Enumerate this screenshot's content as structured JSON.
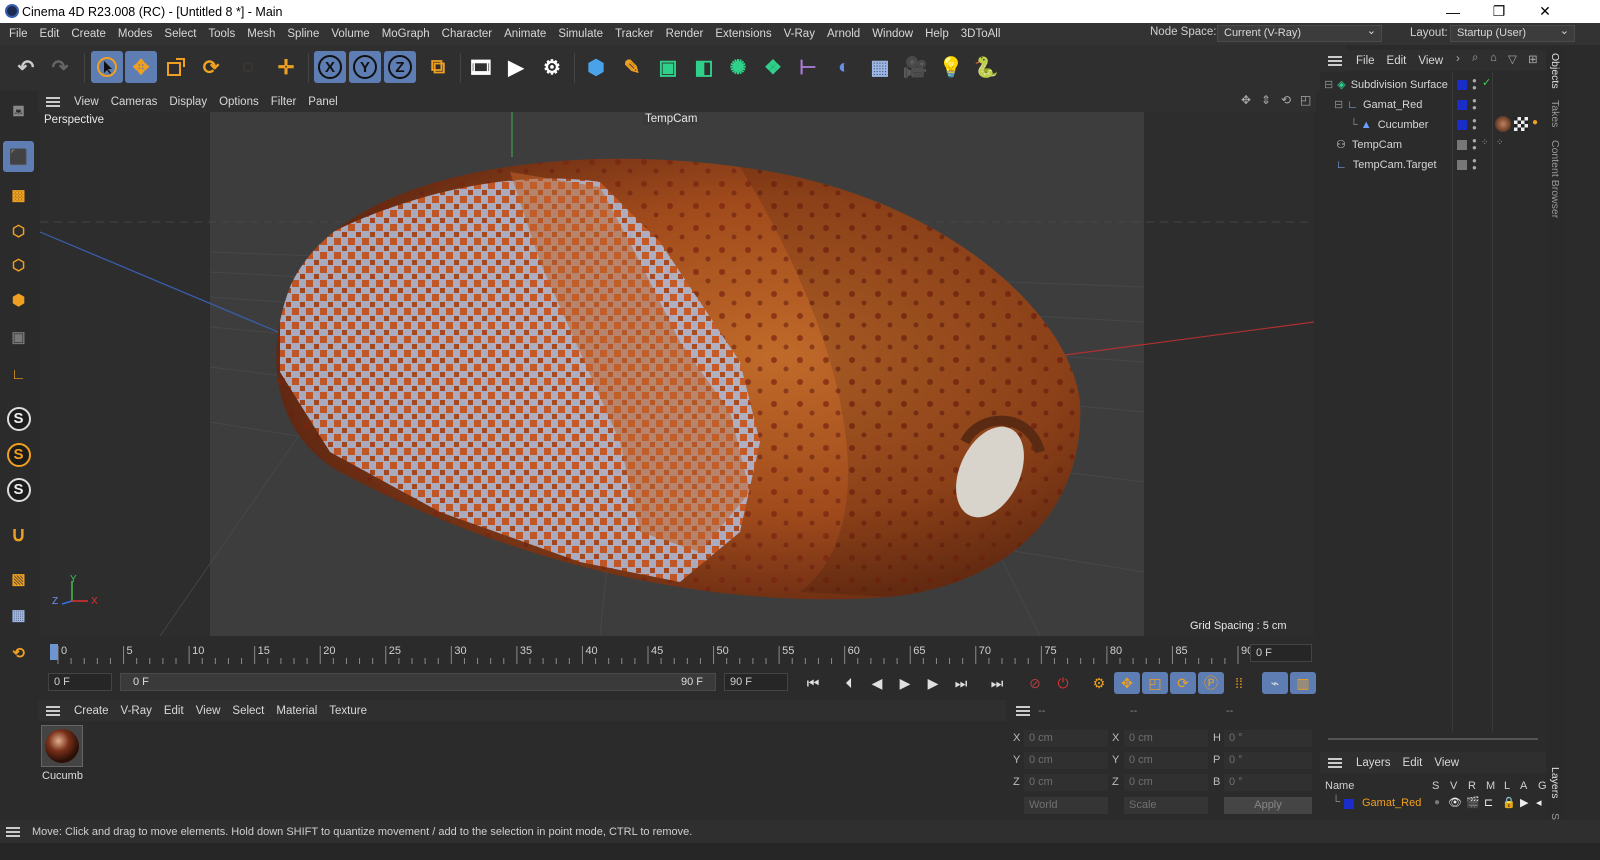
{
  "window": {
    "title": "Cinema 4D R23.008 (RC) - [Untitled 8 *] - Main",
    "minimize": "—",
    "restore": "❐",
    "close": "✕"
  },
  "menu": [
    "File",
    "Edit",
    "Create",
    "Modes",
    "Select",
    "Tools",
    "Mesh",
    "Spline",
    "Volume",
    "MoGraph",
    "Character",
    "Animate",
    "Simulate",
    "Tracker",
    "Render",
    "Extensions",
    "V-Ray",
    "Arnold",
    "Window",
    "Help",
    "3DToAll"
  ],
  "node_space": {
    "label": "Node Space:",
    "value": "Current (V-Ray)"
  },
  "layout": {
    "label": "Layout:",
    "value": "Startup (User)"
  },
  "toolbar_axes": [
    "X",
    "Y",
    "Z"
  ],
  "viewport": {
    "menu": [
      "View",
      "Cameras",
      "Display",
      "Options",
      "Filter",
      "Panel"
    ],
    "name": "Perspective",
    "camera": "TempCam",
    "grid_spacing": "Grid Spacing : 5 cm",
    "axis_labels": {
      "y": "Y",
      "z": "Z",
      "x": "X"
    }
  },
  "timeline": {
    "ticks": [
      "0",
      "5",
      "10",
      "15",
      "20",
      "25",
      "30",
      "35",
      "40",
      "45",
      "50",
      "55",
      "60",
      "65",
      "70",
      "75",
      "80",
      "85",
      "90"
    ],
    "current_frame": "0 F",
    "start_frame": "0 F",
    "range_start": "0 F",
    "range_end": "90 F",
    "end_frame": "90 F"
  },
  "material": {
    "menu": [
      "Create",
      "V-Ray",
      "Edit",
      "View",
      "Select",
      "Material",
      "Texture"
    ],
    "items": [
      {
        "name": "Cucumb"
      }
    ]
  },
  "coords": {
    "headers": [
      "--",
      "--",
      "--"
    ],
    "rows": [
      {
        "a": "X",
        "av": "0 cm",
        "b": "X",
        "bv": "0 cm",
        "c": "H",
        "cv": "0 °"
      },
      {
        "a": "Y",
        "av": "0 cm",
        "b": "Y",
        "bv": "0 cm",
        "c": "P",
        "cv": "0 °"
      },
      {
        "a": "Z",
        "av": "0 cm",
        "b": "Z",
        "bv": "0 cm",
        "c": "B",
        "cv": "0 °"
      }
    ],
    "mode1": "World",
    "mode2": "Scale",
    "apply": "Apply"
  },
  "objects": {
    "menu": [
      "File",
      "Edit",
      "View"
    ],
    "items": [
      {
        "name": "Subdivision Surface",
        "color": "#1a2dc8",
        "highlight": false
      },
      {
        "name": "Gamat_Red",
        "color": "#1a2dc8",
        "highlight": false
      },
      {
        "name": "Cucumber",
        "color": "#1a2dc8",
        "highlight": false
      },
      {
        "name": "TempCam",
        "color": "#777777",
        "highlight": false
      },
      {
        "name": "TempCam.Target",
        "color": "#777777",
        "highlight": false
      }
    ]
  },
  "side_tabs": [
    "Objects",
    "Takes",
    "Content Browser",
    "Layers",
    "Str"
  ],
  "layers": {
    "menu": [
      "Layers",
      "Edit",
      "View"
    ],
    "columns": [
      "Name",
      "S",
      "V",
      "R",
      "M",
      "L",
      "A",
      "G"
    ],
    "items": [
      {
        "name": "Gamat_Red",
        "color": "#1a2dc8"
      }
    ]
  },
  "status": "Move: Click and drag to move elements. Hold down SHIFT to quantize movement / add to the selection in point mode, CTRL to remove.",
  "colors": {
    "accent": "#5d7db3",
    "orange": "#e8a020",
    "bg": "#2b2b2b"
  }
}
